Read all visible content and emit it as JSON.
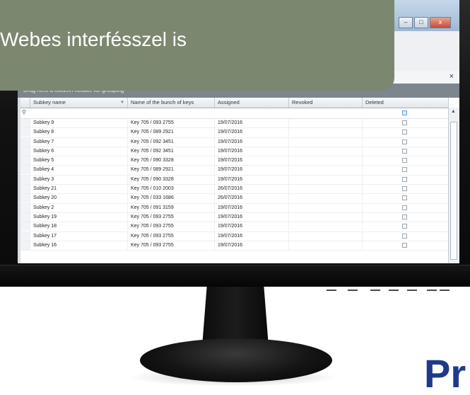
{
  "banner": {
    "text": "Webes interfésszel is"
  },
  "window": {
    "minimize": "–",
    "maximize": "□",
    "close": "x",
    "panel_close": "×"
  },
  "grid": {
    "group_hint": "Drag here a column header for grouping",
    "columns": [
      "Subkey name",
      "Name of the bunch of keys",
      "Assigned",
      "Revoked",
      "Deleted"
    ],
    "rows": [
      [
        "Subkey 9",
        "Key 705 / 093 2755",
        "19/07/2016",
        "",
        false
      ],
      [
        "Subkey 8",
        "Key 705 / 089 2921",
        "19/07/2016",
        "",
        false
      ],
      [
        "Subkey 7",
        "Key 705 / 092 3451",
        "19/07/2016",
        "",
        false
      ],
      [
        "Subkey 6",
        "Key 705 / 092 3451",
        "19/07/2016",
        "",
        false
      ],
      [
        "Subkey 5",
        "Key 705 / 090 3328",
        "19/07/2016",
        "",
        false
      ],
      [
        "Subkey 4",
        "Key 705 / 089 2921",
        "19/07/2016",
        "",
        false
      ],
      [
        "Subkey 3",
        "Key 705 / 090 3328",
        "19/07/2016",
        "",
        false
      ],
      [
        "Subkey 21",
        "Key 705 / 010 2003",
        "26/07/2016",
        "",
        false
      ],
      [
        "Subkey 20",
        "Key 705 / 033 1686",
        "26/07/2016",
        "",
        false
      ],
      [
        "Subkey 2",
        "Key 705 / 091 3159",
        "19/07/2016",
        "",
        false
      ],
      [
        "Subkey 19",
        "Key 705 / 093 2755",
        "19/07/2016",
        "",
        false
      ],
      [
        "Subkey 18",
        "Key 705 / 093 2755",
        "19/07/2016",
        "",
        false
      ],
      [
        "Subkey 17",
        "Key 705 / 093 2755",
        "19/07/2016",
        "",
        false
      ],
      [
        "Subkey 16",
        "Key 705 / 093 2755",
        "19/07/2016",
        "",
        false
      ]
    ]
  },
  "logo": {
    "text": "Pr"
  },
  "colors": {
    "banner": "#7c876f",
    "logo": "#1f3a8a"
  }
}
